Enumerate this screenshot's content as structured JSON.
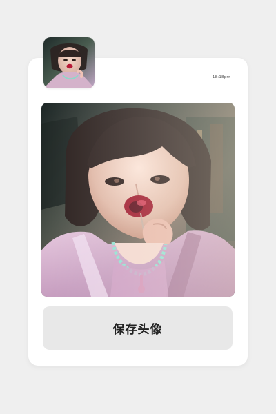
{
  "status": {
    "time": "18:18pm"
  },
  "actions": {
    "save_avatar_label": "保存头像"
  },
  "colors": {
    "background": "#efefef",
    "card": "#ffffff",
    "button": "#e8e8e8",
    "button_text": "#222222"
  },
  "images": {
    "avatar_thumb": "avatar-photo",
    "main_photo": "portrait-photo"
  }
}
